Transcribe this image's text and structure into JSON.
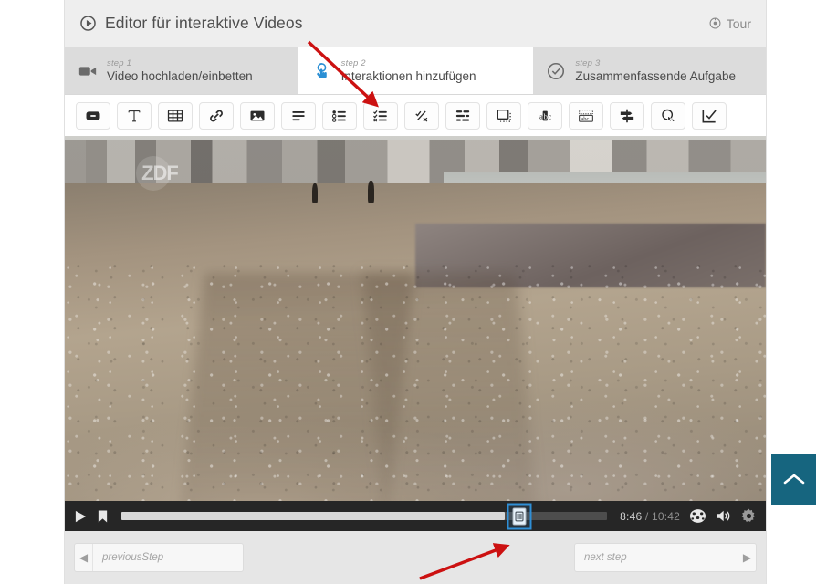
{
  "header": {
    "title": "Editor für interaktive Videos",
    "title_icon": "play-circle-icon",
    "tour_label": "Tour",
    "tour_icon": "tour-target-icon"
  },
  "steps": [
    {
      "step": "step 1",
      "label": "Video hochladen/einbetten",
      "icon": "video-camera-icon",
      "active": false
    },
    {
      "step": "step 2",
      "label": "Interaktionen hinzufügen",
      "icon": "hand-click-icon",
      "active": true
    },
    {
      "step": "step 3",
      "label": "Zusammenfassende Aufgabe",
      "icon": "check-circle-icon",
      "active": false
    }
  ],
  "toolbar": {
    "buttons": [
      {
        "name": "label-button",
        "icon": "label-rounded-icon",
        "title": "Label"
      },
      {
        "name": "text-button",
        "icon": "text-t-icon",
        "title": "Text"
      },
      {
        "name": "table-button",
        "icon": "table-grid-icon",
        "title": "Table"
      },
      {
        "name": "link-button",
        "icon": "link-chain-icon",
        "title": "Link"
      },
      {
        "name": "image-button",
        "icon": "image-picture-icon",
        "title": "Image"
      },
      {
        "name": "statement-button",
        "icon": "list-lines-icon",
        "title": "Statements"
      },
      {
        "name": "single-choice-button",
        "icon": "single-choice-list-icon",
        "title": "Single Choice"
      },
      {
        "name": "multiple-choice-button",
        "icon": "multiple-choice-check-list-icon",
        "title": "Multiple Choice"
      },
      {
        "name": "true-false-button",
        "icon": "true-false-slash-icon",
        "title": "True/False"
      },
      {
        "name": "fill-blanks-button",
        "icon": "fill-in-blanks-icon",
        "title": "Fill in the Blanks"
      },
      {
        "name": "drag-drop-button",
        "icon": "drag-drop-frame-icon",
        "title": "Drag and Drop"
      },
      {
        "name": "mark-words-button",
        "icon": "mark-the-words-abc-icon",
        "title": "Mark the Words"
      },
      {
        "name": "drag-text-button",
        "icon": "drag-text-abc-icon",
        "title": "Drag Text"
      },
      {
        "name": "crossroads-button",
        "icon": "crossroads-signpost-icon",
        "title": "Crossroads"
      },
      {
        "name": "navigation-hotspot-button",
        "icon": "navigation-hotspot-icon",
        "title": "Navigation Hotspot"
      },
      {
        "name": "submit-screen-button",
        "icon": "submit-screen-check-icon",
        "title": "Submit Screen"
      }
    ]
  },
  "video": {
    "watermark": "ZDF",
    "alt": "beach-shoreline-footage"
  },
  "player": {
    "play_icon": "play-triangle-icon",
    "bookmark_icon": "bookmark-icon",
    "current_time": "8:46",
    "separator": "/",
    "total_time": "10:42",
    "played_percent": 79,
    "marker_percent": 82,
    "speed_icon": "playback-speed-icon",
    "volume_icon": "volume-speaker-icon",
    "settings_icon": "gear-settings-icon",
    "marker_icon": "interaction-marker-icon",
    "marker_selected": true
  },
  "bottom_nav": {
    "previous_label": "previousStep",
    "previous_icon": "chevron-left-icon",
    "next_label": "next step",
    "next_icon": "chevron-right-icon"
  },
  "fab": {
    "name": "scroll-to-top-button",
    "icon": "chevron-up-icon",
    "color": "#16657f"
  },
  "annotations": {
    "arrow_color": "#cc1111",
    "arrows": [
      {
        "name": "arrow-to-multiple-choice-tool",
        "points_to": "multiple-choice-button"
      },
      {
        "name": "arrow-to-timeline-marker",
        "points_to": "seek-marker"
      }
    ]
  }
}
